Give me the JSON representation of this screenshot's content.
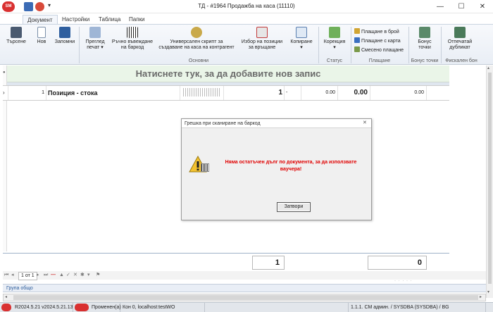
{
  "window": {
    "title": "ТД - #1964 Продажба на каса (11110)",
    "minimize": "—",
    "maximize": "☐",
    "close": "✕"
  },
  "tabs": [
    "Документ",
    "Настройки",
    "Таблица",
    "Папки"
  ],
  "ribbon": {
    "search": "Търсене",
    "new": "Нов",
    "save": "Запомни",
    "preview_print": "Преглед\nпечат",
    "manual_barcode": "Ръчно въвеждане\nна баркод",
    "universal_script": "Универсален скрипт за\nсъздаване на каса на контрагент",
    "select_return": "Избор на позиции\nза връщане",
    "copy": "Копиране",
    "correction": "Корекция",
    "pay_cash": "Плащане в брой",
    "pay_card": "Плащане с карта",
    "pay_mixed": "Смесено плащане",
    "bonus_points": "Бонус\nточки",
    "print_duplicate": "Отпечатай\nдубликат",
    "group_basic": "Основни",
    "group_status": "Статус",
    "group_payment": "Плащане",
    "group_bonus": "Бонус точки",
    "group_fiscal": "Фискален бон"
  },
  "grid": {
    "add_record": "Натиснете тук, за да добавите нов запис",
    "row": {
      "number": "1",
      "name": "Позиция - стока",
      "quantity": "1",
      "unit": "-",
      "price": "0.00",
      "total": "0.00",
      "discount": "0.00"
    }
  },
  "dialog": {
    "title": "Грешка при сканиране на баркод",
    "close_x": "✕",
    "message": "Няма остатъчен дълг по документа, за да използвате ваучера!",
    "button": "Затвори"
  },
  "totals": {
    "qty": "1",
    "amount": "0"
  },
  "nav": {
    "page": "1 от 1"
  },
  "group_bar": "Група общо",
  "status": {
    "version": "R2024.5.21 v2024.5.21.13",
    "state": "Променен(а)",
    "connection": "Кон 0, localhost:testWO",
    "user": "1.1.1. CM админ. / SYSDBA (SYSDBA) / BG"
  },
  "colors": {
    "accent": "#e03a3a",
    "ribbon_bg": "#e9eef5",
    "add_row_bg": "#eaf5e8",
    "error_text": "#e00000"
  }
}
